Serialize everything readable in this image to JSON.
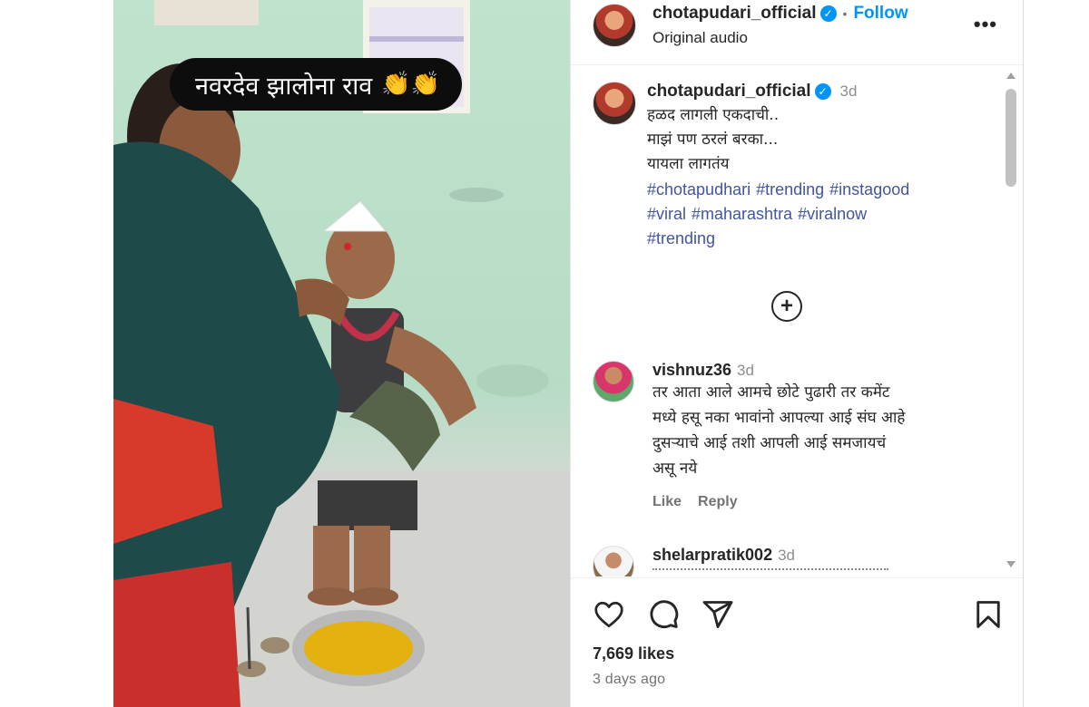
{
  "media": {
    "overlay_caption": "नवरदेव झालोना राव",
    "overlay_emoji": "👏👏"
  },
  "post": {
    "username": "chotapudari_official",
    "verified": true,
    "follow_label": "Follow",
    "separator": "•",
    "audio_label": "Original audio",
    "more_options": "•••"
  },
  "caption": {
    "username": "chotapudari_official",
    "time": "3d",
    "lines": [
      "हळद लागली एकदाची..",
      "माझं पण ठरलं बरका...",
      "यायला लागतंय"
    ],
    "hashtags": [
      "#chotapudhari",
      "#trending",
      "#instagood",
      "#viral",
      "#maharashtra",
      "#viralnow",
      "#trending"
    ]
  },
  "load_more": "+",
  "comments": [
    {
      "username": "vishnuz36",
      "time": "3d",
      "lines": [
        "तर आता आले आमचे छोटे पुढारी तर कमेंट",
        "मध्ये हसू नका भावांनो आपल्या आई संघ आहे",
        "दुसऱ्याचे आई तशी आपली आई समजायचं",
        "असू नये"
      ],
      "like_label": "Like",
      "reply_label": "Reply"
    },
    {
      "username": "shelarpratik002",
      "time": "3d"
    }
  ],
  "stats": {
    "likes": "7,669 likes",
    "posted": "3 days ago"
  },
  "icons": {
    "like": "heart-icon",
    "comment": "comment-icon",
    "share": "share-icon",
    "save": "bookmark-icon",
    "verified": "verified-badge-icon"
  },
  "colors": {
    "accent": "#0095f6",
    "hashtag": "#4155a3",
    "muted": "#737373"
  }
}
